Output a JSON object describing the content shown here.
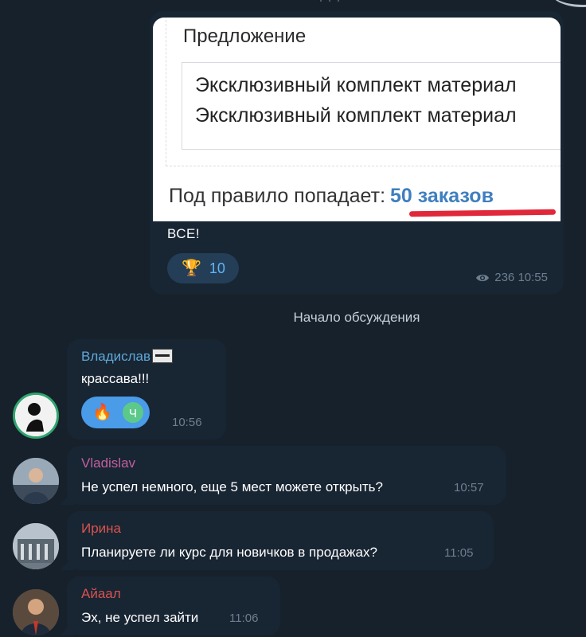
{
  "post": {
    "image": {
      "offer_label": "Предложение",
      "offer_lines": [
        "Эксклюзивный комплект материал",
        "Эксклюзивный комплект материал"
      ],
      "rule_prefix": "Под правило попадает:",
      "rule_link": "50 заказов"
    },
    "text": "ВСЕ!",
    "reaction": {
      "icon": "trophy-icon",
      "emoji": "🏆",
      "count": "10"
    },
    "views": "236",
    "time": "10:55"
  },
  "discussion_start": "Начало обсуждения",
  "comments": [
    {
      "author": "Владислав",
      "author_color": "#5fa8d8",
      "text": "крассава!!!",
      "reactions": {
        "emoji": "🔥",
        "avatar_letter": "Ч"
      },
      "time": "10:56"
    },
    {
      "author": "Vladislav",
      "author_color": "#c25fa1",
      "text": "Не успел немного, еще 5 мест можете открыть?",
      "time": "10:57"
    },
    {
      "author": "Ирина",
      "author_color": "#d9534f",
      "text": "Планируете ли курс для новичков в продажах?",
      "time": "11:05"
    },
    {
      "author": "Айаал",
      "author_color": "#d9534f",
      "text": "Эх, не успел зайти",
      "time": "11:06"
    }
  ]
}
